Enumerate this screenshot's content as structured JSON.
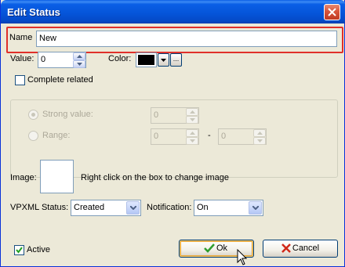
{
  "window": {
    "title": "Edit Status"
  },
  "name": {
    "label": "Name",
    "value": "New"
  },
  "value": {
    "label": "Value:",
    "value": "0"
  },
  "color": {
    "label": "Color:",
    "swatch": "#000000",
    "more_label": "..."
  },
  "complete_related": {
    "label": "Complete related",
    "checked": false
  },
  "strong_value": {
    "label": "Strong value:",
    "value": "0"
  },
  "range": {
    "label": "Range:",
    "from": "0",
    "separator": "-",
    "to": "0"
  },
  "image": {
    "label": "Image:",
    "hint": "Right click on the box to  change image"
  },
  "vpxml_status": {
    "label": "VPXML Status:",
    "value": "Created"
  },
  "notification": {
    "label": "Notification:",
    "value": "On"
  },
  "active": {
    "label": "Active",
    "checked": true
  },
  "buttons": {
    "ok": "Ok",
    "cancel": "Cancel"
  },
  "colors": {
    "titlebar": "#0554d8",
    "highlight": "#e0302a",
    "ok_icon": "#2f9e2f",
    "cancel_icon": "#d02818"
  }
}
